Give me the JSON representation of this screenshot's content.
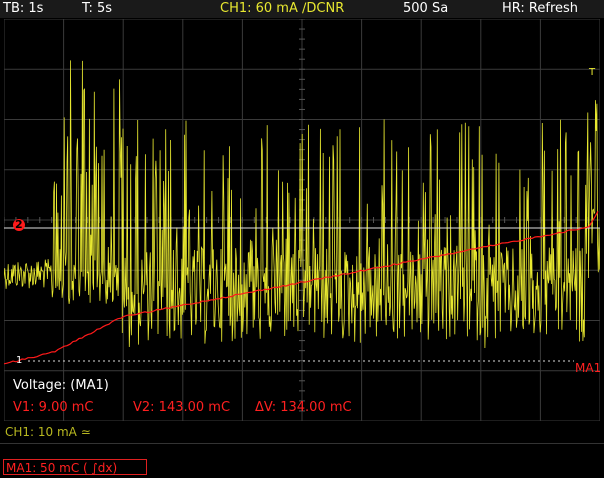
{
  "header": {
    "timebase": "TB: 1s",
    "trigger_time": "T: 5s",
    "channel": "CH1: 60 mA ∕DCNR",
    "samples": "500 Sa",
    "mode": "HR: Refresh"
  },
  "markers": {
    "ch2_marker": "2",
    "ch1_ground": "1",
    "math_label": "MA1",
    "trigger_marker": "T"
  },
  "info_panel": {
    "title": "Voltage: (MA1)",
    "v1": "V1: 9.00 mC",
    "v2": "V2: 143.00 mC",
    "delta_v": "ΔV: 134.00 mC"
  },
  "footer": {
    "ch1_setting": "CH1: 10 mA ≃",
    "ma1_setting": "MA1: 50 mC ( ∫dx)"
  },
  "colors": {
    "ch1": "#e8e830",
    "math": "#ff1a1a",
    "grid": "#3a3a3a",
    "cursor": "#e0e0e0"
  }
}
